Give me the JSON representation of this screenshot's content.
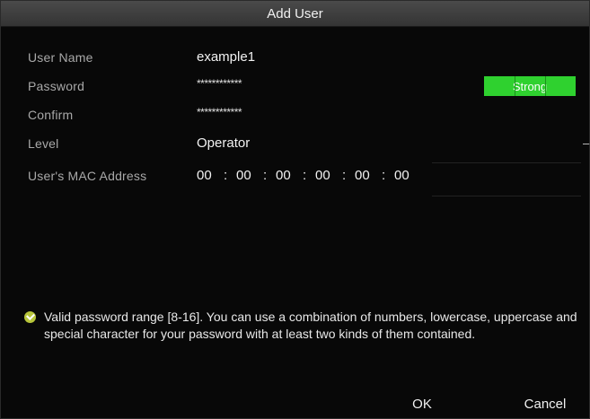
{
  "dialog": {
    "title": "Add User"
  },
  "fields": {
    "user_name": {
      "label": "User Name",
      "value": "example1"
    },
    "password": {
      "label": "Password",
      "value": "************",
      "strength": "Strong",
      "strength_color": "#2fd12f"
    },
    "confirm": {
      "label": "Confirm",
      "value": "************"
    },
    "level": {
      "label": "Level",
      "value": "Operator"
    },
    "mac": {
      "label": "User's MAC Address",
      "octets": [
        "00",
        "00",
        "00",
        "00",
        "00",
        "00"
      ],
      "separator": ":"
    }
  },
  "hint": {
    "icon": "check-circle-icon",
    "text": "Valid password range [8-16]. You can use a combination of numbers, lowercase, uppercase and special character for your password with at least two kinds of them contained."
  },
  "buttons": {
    "ok": "OK",
    "cancel": "Cancel"
  }
}
